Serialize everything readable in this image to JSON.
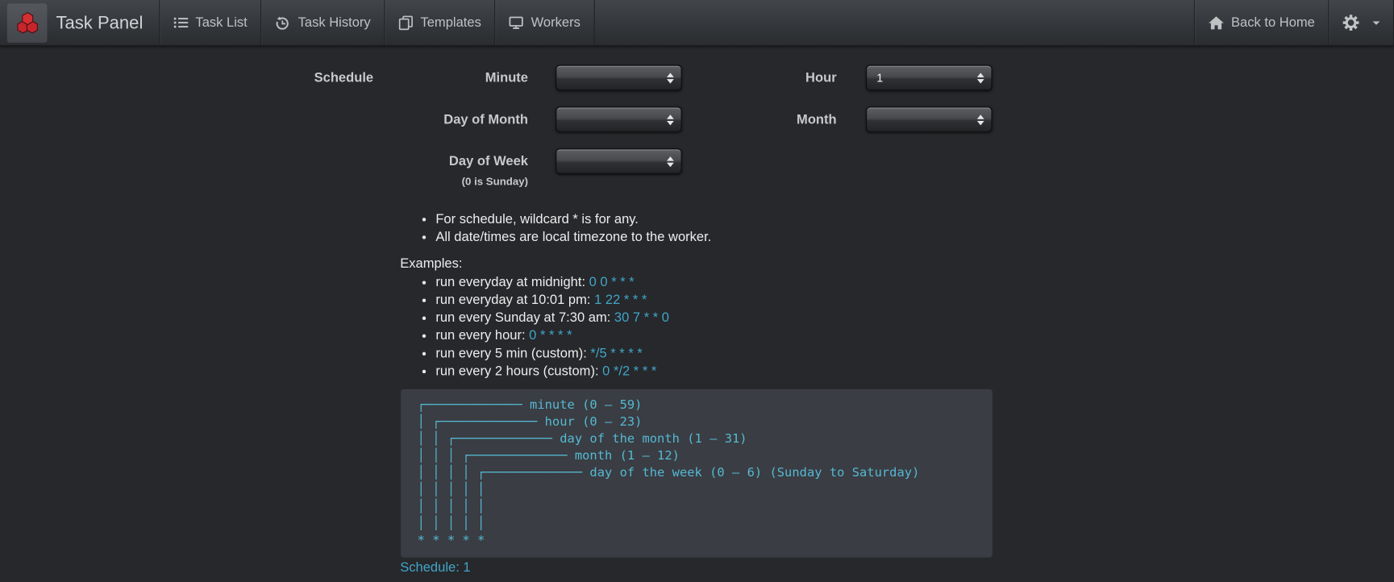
{
  "navbar": {
    "brand": "Task Panel",
    "items": [
      {
        "label": "Task List"
      },
      {
        "label": "Task History"
      },
      {
        "label": "Templates"
      },
      {
        "label": "Workers"
      }
    ],
    "back_to_home": "Back to Home"
  },
  "form": {
    "section_label": "Schedule",
    "fields": {
      "minute": {
        "label": "Minute",
        "value": ""
      },
      "hour": {
        "label": "Hour",
        "value": "1"
      },
      "day_of_month": {
        "label": "Day of Month",
        "value": ""
      },
      "month": {
        "label": "Month",
        "value": ""
      },
      "day_of_week": {
        "label": "Day of Week",
        "value": "",
        "note": "(0 is Sunday)"
      }
    }
  },
  "notes": {
    "items": [
      {
        "text": "For schedule, wildcard * is for any."
      },
      {
        "text": "All date/times are local timezone to the worker."
      }
    ]
  },
  "examples": {
    "heading": "Examples:",
    "items": [
      {
        "text": "run everyday at midnight: ",
        "code": "0 0 * * *"
      },
      {
        "text": "run everyday at 10:01 pm: ",
        "code": "1 22 * * *"
      },
      {
        "text": "run every Sunday at 7:30 am: ",
        "code": "30 7 * * 0"
      },
      {
        "text": "run every hour: ",
        "code": "0 * * * *"
      },
      {
        "text": "run every 5 min (custom): ",
        "code": "*/5 * * * *"
      },
      {
        "text": "run every 2 hours (custom): ",
        "code": "0 */2 * * *"
      }
    ]
  },
  "diagram": {
    "text": " ┌───────────── minute (0 – 59)\n │ ┌───────────── hour (0 – 23)\n │ │ ┌───────────── day of the month (1 – 31)\n │ │ │ ┌───────────── month (1 – 12)\n │ │ │ │ ┌───────────── day of the week (0 – 6) (Sunday to Saturday)\n │ │ │ │ │\n │ │ │ │ │\n │ │ │ │ │\n * * * * *"
  },
  "footer": {
    "schedule_summary": "Schedule: 1"
  },
  "colors": {
    "page_bg": "#26282b",
    "navbar_top": "#42454a",
    "navbar_bottom": "#2a2c2f",
    "example_code_cyan": "#42a4c8",
    "diagram_text_cyan": "#55b9d3",
    "diagram_bg": "#3a3d43",
    "logo_red": "#c5262c"
  }
}
